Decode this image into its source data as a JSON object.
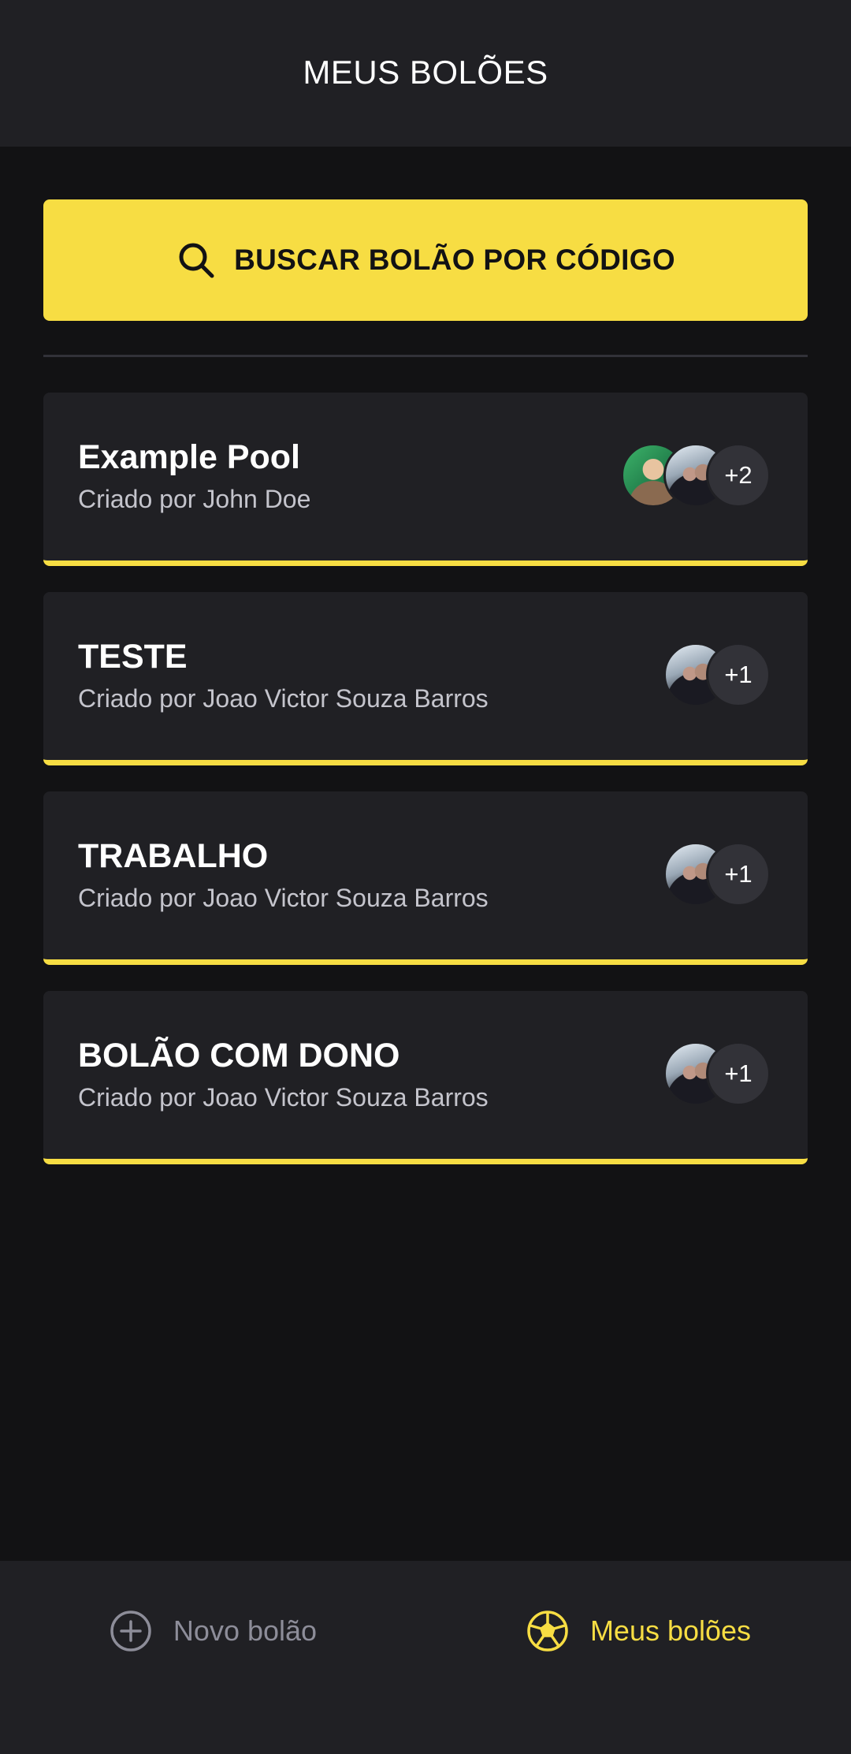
{
  "header": {
    "title": "MEUS BOLÕES"
  },
  "search": {
    "icon": "search-icon",
    "label": "BUSCAR BOLÃO POR CÓDIGO"
  },
  "pools": [
    {
      "title": "Example Pool",
      "owner_prefix": "Criado por",
      "owner": "John Doe",
      "extra_participants": "+2"
    },
    {
      "title": "TESTE",
      "owner_prefix": "Criado por",
      "owner": "Joao Victor Souza Barros",
      "extra_participants": "+1"
    },
    {
      "title": "TRABALHO",
      "owner_prefix": "Criado por",
      "owner": "Joao Victor Souza Barros",
      "extra_participants": "+1"
    },
    {
      "title": "BOLÃO COM DONO",
      "owner_prefix": "Criado por",
      "owner": "Joao Victor Souza Barros",
      "extra_participants": "+1"
    }
  ],
  "tabbar": {
    "new_pool": {
      "label": "Novo bolão",
      "icon": "plus-circle-icon"
    },
    "my_pools": {
      "label": "Meus bolões",
      "icon": "soccer-ball-icon"
    }
  },
  "colors": {
    "background": "#121214",
    "surface": "#202024",
    "accent": "#f7dd43",
    "text_primary": "#ffffff",
    "text_secondary": "#c4c4cc",
    "text_muted": "#8d8d99"
  }
}
